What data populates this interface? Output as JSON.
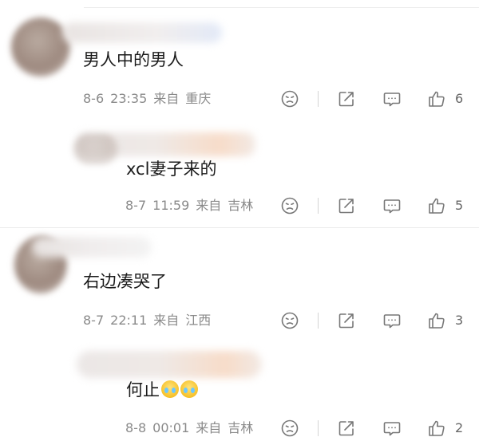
{
  "comments": [
    {
      "text": "男人中的男人",
      "date": "8-6",
      "time": "23:35",
      "from": "来自",
      "location": "重庆",
      "likes": "6"
    },
    {
      "text": "xcl妻子来的",
      "date": "8-7",
      "time": "11:59",
      "from": "来自",
      "location": "吉林",
      "likes": "5"
    },
    {
      "text": "右边凑哭了",
      "date": "8-7",
      "time": "22:11",
      "from": "来自",
      "location": "江西",
      "likes": "3"
    },
    {
      "text": "何止",
      "date": "8-8",
      "time": "00:01",
      "from": "来自",
      "location": "吉林",
      "likes": "2"
    }
  ],
  "icons": [
    "dislike-face-icon",
    "share-icon",
    "comment-icon",
    "thumbs-up-icon",
    "crying-emoji-icon"
  ],
  "colors": {
    "text": "#1b1b1b",
    "meta": "#8a8a8a",
    "icon": "#777777",
    "divider": "#ececec"
  }
}
